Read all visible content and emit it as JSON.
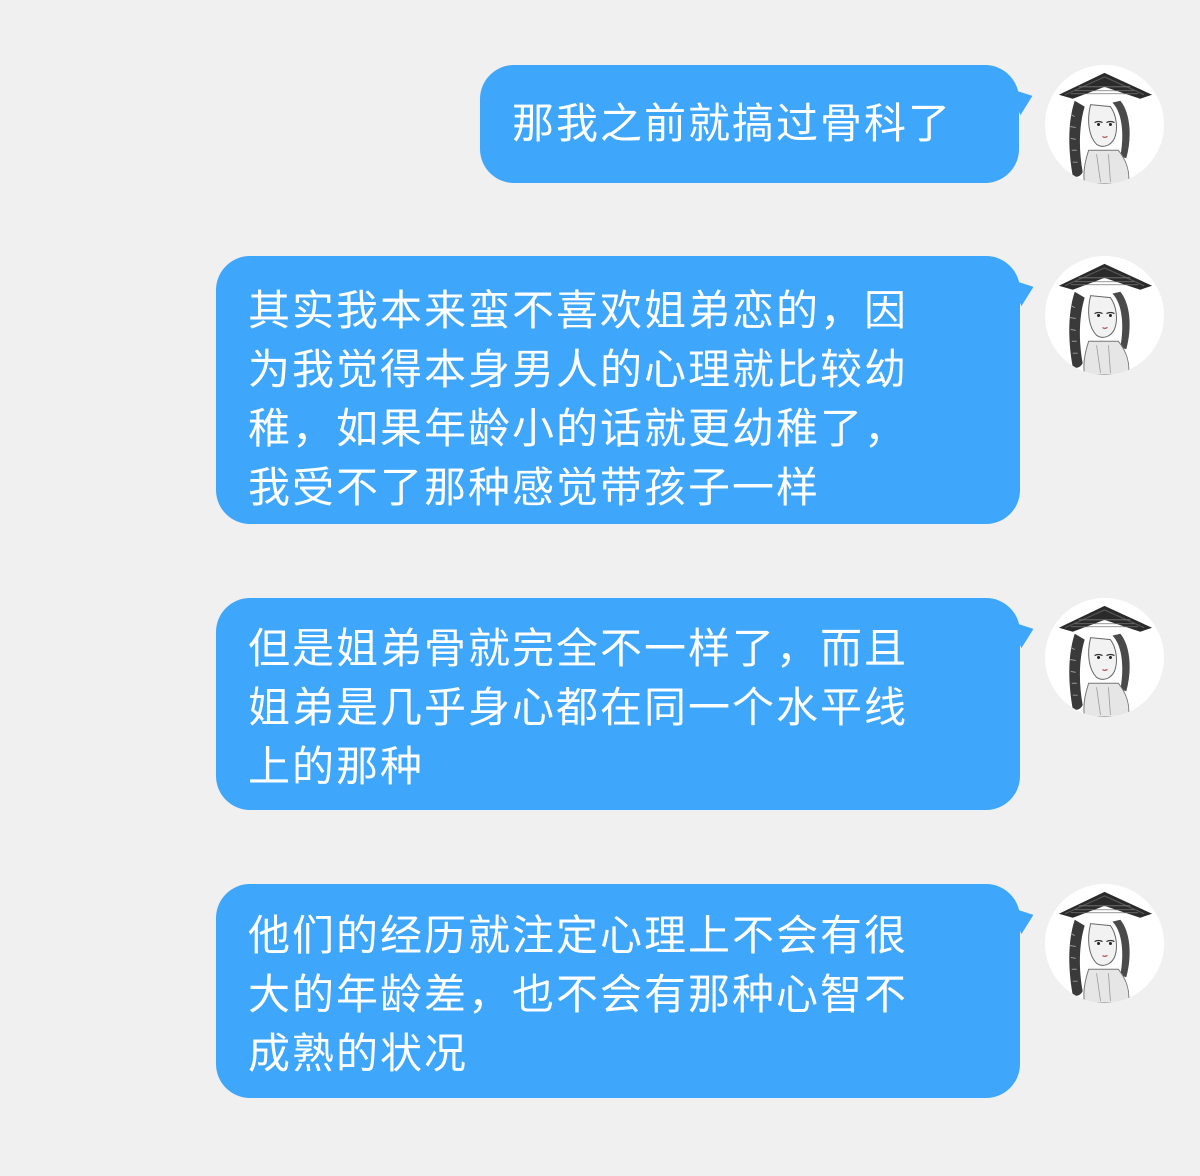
{
  "messages": [
    {
      "text": "那我之前就搞过骨科了"
    },
    {
      "text": "其实我本来蛮不喜欢姐弟恋的，因\n为我觉得本身男人的心理就比较幼\n稚，如果年龄小的话就更幼稚了，\n我受不了那种感觉带孩子一样"
    },
    {
      "text": "但是姐弟骨就完全不一样了，而且\n姐弟是几乎身心都在同一个水平线\n上的那种"
    },
    {
      "text": "他们的经历就注定心理上不会有很\n大的年龄差，也不会有那种心智不\n成熟的状况"
    }
  ],
  "colors": {
    "background": "#f0f0f0",
    "bubble": "#3ea6fb",
    "bubble_text": "#ffffff"
  },
  "avatar": {
    "icon": "ink-sketch-avatar-icon"
  }
}
